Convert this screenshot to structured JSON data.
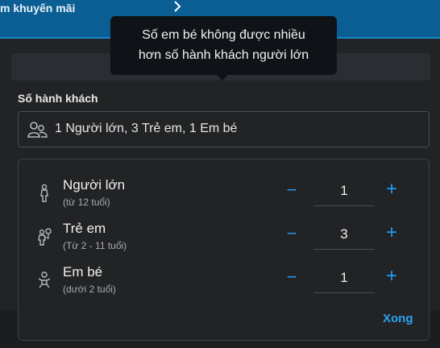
{
  "promo": {
    "label": "m khuyến mãi",
    "chevron_icon": "chevron-right-icon"
  },
  "tooltip": {
    "line1": "Số em bé không được nhiều",
    "line2": "hơn số hành khách người lớn"
  },
  "passengers": {
    "section_label": "Số hành khách",
    "summary": "1 Người lớn, 3 Trẻ em, 1 Em bé",
    "field_icon": "people-icon"
  },
  "rows": [
    {
      "title": "Người lớn",
      "age": "(từ 12 tuổi)",
      "qty": "1",
      "icon": "adult-icon",
      "minus": "−",
      "plus": "+"
    },
    {
      "title": "Trẻ em",
      "age": "(Từ 2 - 11 tuổi)",
      "qty": "3",
      "icon": "child-icon",
      "minus": "−",
      "plus": "+"
    },
    {
      "title": "Em bé",
      "age": "(dưới 2 tuổi)",
      "qty": "1",
      "icon": "infant-icon",
      "minus": "−",
      "plus": "+"
    }
  ],
  "done_label": "Xong",
  "colors": {
    "accent": "#1f9bf0",
    "promo_bg": "#0b5e93",
    "panel_bg": "#222325",
    "tooltip_bg": "#0f1216"
  }
}
